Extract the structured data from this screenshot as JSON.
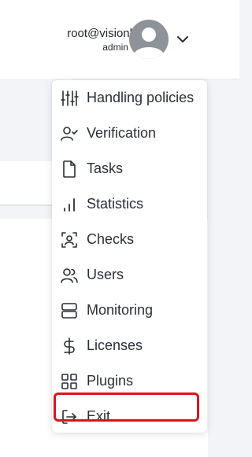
{
  "user": {
    "email": "root@visionlabs.ai",
    "role": "admin"
  },
  "menu": {
    "items": [
      {
        "label": "Handling policies",
        "icon": "sliders-icon"
      },
      {
        "label": "Verification",
        "icon": "user-check-icon"
      },
      {
        "label": "Tasks",
        "icon": "file-icon"
      },
      {
        "label": "Statistics",
        "icon": "bar-chart-icon"
      },
      {
        "label": "Checks",
        "icon": "face-scan-icon"
      },
      {
        "label": "Users",
        "icon": "users-icon"
      },
      {
        "label": "Monitoring",
        "icon": "server-icon"
      },
      {
        "label": "Licenses",
        "icon": "dollar-icon"
      },
      {
        "label": "Plugins",
        "icon": "grid-icon"
      },
      {
        "label": "Exit",
        "icon": "logout-icon"
      }
    ]
  },
  "colors": {
    "highlight": "#e0101f",
    "avatar": "#8e9299",
    "text": "#2a2e36"
  }
}
